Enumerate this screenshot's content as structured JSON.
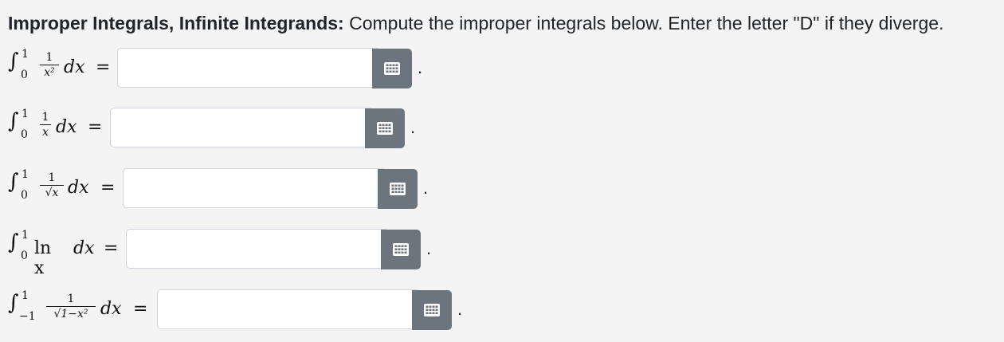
{
  "instructions": {
    "bold": "Improper Integrals, Infinite Integrands:",
    "text": " Compute the improper integrals below. Enter the letter \"D\" if they diverge."
  },
  "problems": [
    {
      "lower": "0",
      "upper": "1",
      "num": "1",
      "den": "x²",
      "expr": "",
      "dx": "dx",
      "eq": "=",
      "value": "",
      "period": "."
    },
    {
      "lower": "0",
      "upper": "1",
      "num": "1",
      "den": "x",
      "expr": "",
      "dx": "dx",
      "eq": "=",
      "value": "",
      "period": "."
    },
    {
      "lower": "0",
      "upper": "1",
      "num": "1",
      "den": "√x",
      "expr": "",
      "dx": "dx",
      "eq": "=",
      "value": "",
      "period": "."
    },
    {
      "lower": "0",
      "upper": "1",
      "num": "",
      "den": "",
      "expr": "ln x",
      "dx": "dx",
      "eq": "=",
      "value": "",
      "period": "."
    },
    {
      "lower": "−1",
      "upper": "1",
      "num": "1",
      "den": "√1−x²",
      "expr": "",
      "dx": "dx",
      "eq": "=",
      "value": "",
      "period": "."
    }
  ],
  "icons": {
    "keyboard": "keyboard-icon"
  }
}
